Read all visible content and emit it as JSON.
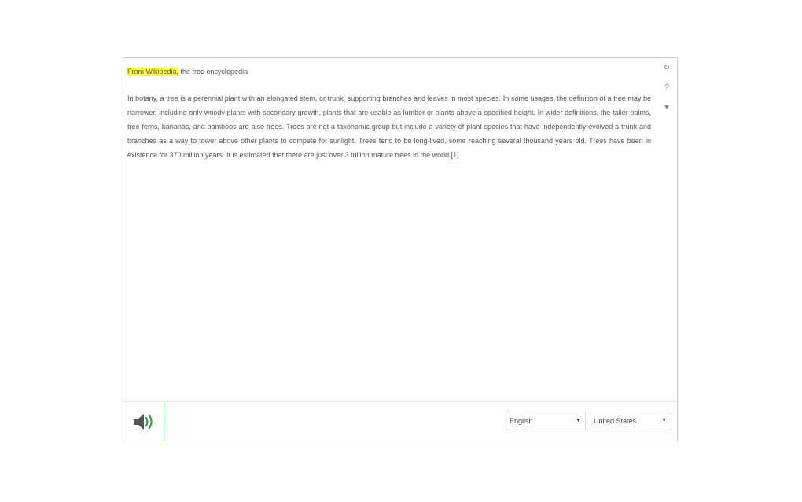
{
  "content": {
    "source_highlight": "From Wikipedia,",
    "source_rest": " the free encyclopedia",
    "paragraph": "In botany, a tree is a perennial plant with an elongated stem, or trunk, supporting branches and leaves in most species. In some usages, the definition of a tree may be narrower, including only woody plants with secondary growth, plants that are usable as lumber or plants above a specified height. In wider definitions, the taller palms, tree ferns, bananas, and bamboos are also trees. Trees are not a taxonomic group but include a variety of plant species that have independently evolved a trunk and branches as a way to tower above other plants to compete for sunlight. Trees tend to be long-lived, some reaching several thousand years old. Trees have been in existence for 370 million years. It is estimated that there are just over 3 trillion mature trees in the world.[1]"
  },
  "side_icons": {
    "refresh": "↻",
    "help": "?",
    "favorite": "♥"
  },
  "bottom_bar": {
    "language": "English",
    "region": "United States",
    "dropdown_arrow": "▼"
  },
  "colors": {
    "highlight": "#ffff3a",
    "speaker_waves": "#2ea043",
    "speaker_body": "#555555"
  }
}
